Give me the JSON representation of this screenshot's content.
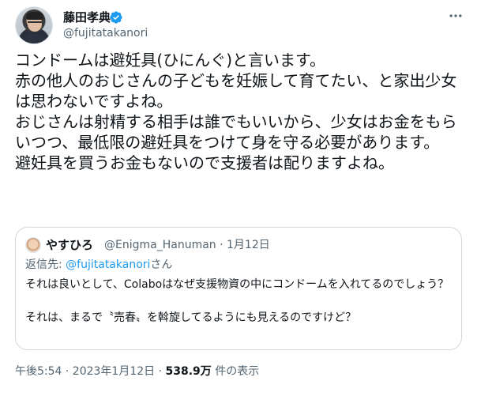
{
  "author": {
    "display_name": "藤田孝典",
    "handle": "@fujitatakanori",
    "verified": true,
    "verified_color": "#1d9bf0"
  },
  "tweet": {
    "text": "コンドームは避妊具(ひにんぐ)と言います。\n赤の他人のおじさんの子どもを妊娠して育てたい、と家出少女は思わないですよね。\nおじさんは射精する相手は誰でもいいから、少女はお金をもらいつつ、最低限の避妊具をつけて身を守る必要があります。\n避妊具を買うお金もないので支援者は配りますよね。"
  },
  "quote": {
    "display_name": "やすひろ",
    "handle_time": "@Enigma_Hanuman · 1月12日",
    "reply_prefix": "返信先: ",
    "reply_to": "@fujitatakanori",
    "reply_suffix": "さん",
    "text": "それは良いとして、Colaboはなぜ支援物資の中にコンドームを入れてるのでしょう？\n\nそれは、まるで〝売春〟を斡旋してるようにも見えるのですけど？"
  },
  "meta": {
    "timestamp": "午後5:54 · 2023年1月12日 · ",
    "views_count": "538.9万",
    "views_label": " 件の表示"
  },
  "icons": {
    "verified": "verified-badge-icon",
    "more": "more-horizontal-icon"
  },
  "colors": {
    "link": "#1d9bf0",
    "secondary_text": "#536471",
    "border": "#cfd9de"
  }
}
